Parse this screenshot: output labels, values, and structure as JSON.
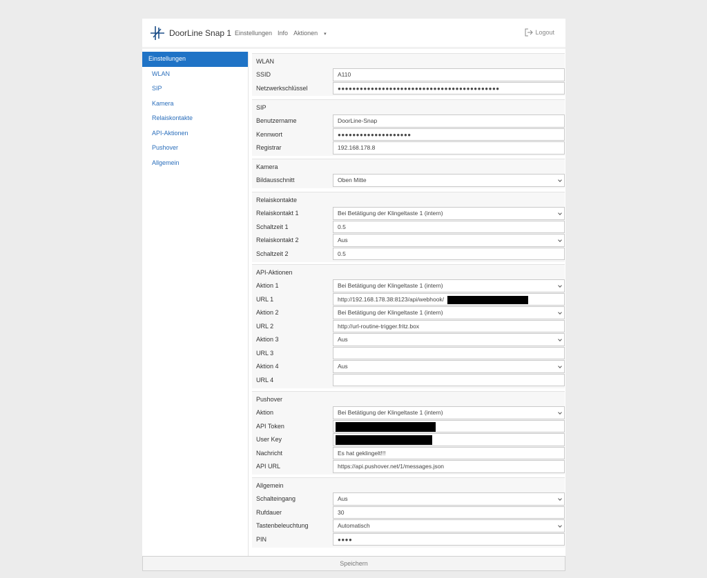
{
  "header": {
    "brand": "DoorLine Snap 1",
    "nav": {
      "settings": "Einstellungen",
      "info": "Info",
      "actions": "Aktionen"
    },
    "logout": "Logout"
  },
  "sidebar": {
    "items": [
      {
        "label": "Einstellungen",
        "active": true
      },
      {
        "label": "WLAN"
      },
      {
        "label": "SIP"
      },
      {
        "label": "Kamera"
      },
      {
        "label": "Relaiskontakte"
      },
      {
        "label": "API-Aktionen"
      },
      {
        "label": "Pushover"
      },
      {
        "label": "Allgemein"
      }
    ]
  },
  "wlan": {
    "title": "WLAN",
    "ssid_label": "SSID",
    "ssid_value": "A110",
    "key_label": "Netzwerkschlüssel",
    "key_value": "●●●●●●●●●●●●●●●●●●●●●●●●●●●●●●●●●●●●●●●●●●●●"
  },
  "sip": {
    "title": "SIP",
    "user_label": "Benutzername",
    "user_value": "DoorLine-Snap",
    "pw_label": "Kennwort",
    "pw_value": "●●●●●●●●●●●●●●●●●●●●",
    "registrar_label": "Registrar",
    "registrar_value": "192.168.178.8"
  },
  "camera": {
    "title": "Kamera",
    "crop_label": "Bildausschnitt",
    "crop_value": "Oben Mitte"
  },
  "relay": {
    "title": "Relaiskontakte",
    "r1_label": "Relaiskontakt 1",
    "r1_value": "Bei Betätigung der Klingeltaste 1 (intern)",
    "t1_label": "Schaltzeit 1",
    "t1_value": "0.5",
    "r2_label": "Relaiskontakt 2",
    "r2_value": "Aus",
    "t2_label": "Schaltzeit 2",
    "t2_value": "0.5"
  },
  "api": {
    "title": "API-Aktionen",
    "a1_label": "Aktion 1",
    "a1_value": "Bei Betätigung der Klingeltaste 1 (intern)",
    "u1_label": "URL 1",
    "u1_value": "http://192.168.178.38:8123/api/webhook/",
    "a2_label": "Aktion 2",
    "a2_value": "Bei Betätigung der Klingeltaste 1 (intern)",
    "u2_label": "URL 2",
    "u2_value": "http://url-routine-trigger.fritz.box",
    "a3_label": "Aktion 3",
    "a3_value": "Aus",
    "u3_label": "URL 3",
    "u3_value": "",
    "a4_label": "Aktion 4",
    "a4_value": "Aus",
    "u4_label": "URL 4",
    "u4_value": ""
  },
  "pushover": {
    "title": "Pushover",
    "action_label": "Aktion",
    "action_value": "Bei Betätigung der Klingeltaste 1 (intern)",
    "token_label": "API Token",
    "userkey_label": "User Key",
    "msg_label": "Nachricht",
    "msg_value": "Es hat geklingelt!!!",
    "url_label": "API URL",
    "url_value": "https://api.pushover.net/1/messages.json"
  },
  "general": {
    "title": "Allgemein",
    "input_label": "Schalteingang",
    "input_value": "Aus",
    "ring_label": "Rufdauer",
    "ring_value": "30",
    "light_label": "Tastenbeleuchtung",
    "light_value": "Automatisch",
    "pin_label": "PIN",
    "pin_value": "●●●●"
  },
  "footer": {
    "save": "Speichern"
  }
}
